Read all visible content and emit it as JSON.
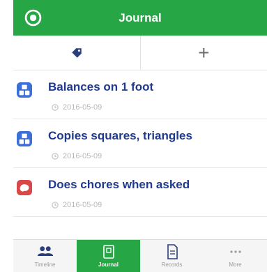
{
  "header": {
    "title": "Journal"
  },
  "toolbar": {
    "add_label": "+"
  },
  "entries": [
    {
      "title": "Balances on 1 foot",
      "date": "2016-05-09",
      "category_color": "#3c6fd8"
    },
    {
      "title": "Copies squares, triangles",
      "date": "2016-05-09",
      "category_color": "#3c6fd8"
    },
    {
      "title": "Does chores when asked",
      "date": "2016-05-09",
      "category_color": "#d94848"
    }
  ],
  "tabs": [
    {
      "label": "Timeline",
      "icon": "people-icon",
      "active": false
    },
    {
      "label": "Journal",
      "icon": "journal-icon",
      "active": true
    },
    {
      "label": "Records",
      "icon": "document-icon",
      "active": false
    },
    {
      "label": "More",
      "icon": "dots-icon",
      "active": false
    }
  ],
  "colors": {
    "brand_green": "#26a645",
    "title_blue": "#1f3a8f"
  }
}
